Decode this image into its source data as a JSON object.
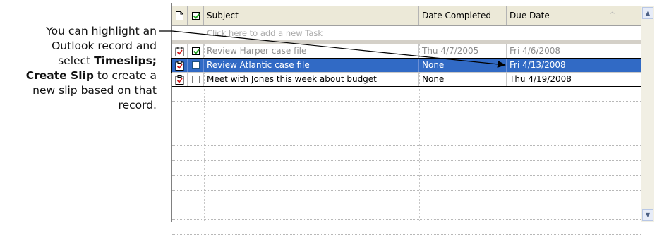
{
  "callout": {
    "line1": "You can highlight an",
    "line2": "Outlook record and",
    "line3_prefix": "select ",
    "line3_bold": "Timeslips;",
    "line4_bold": "Create Slip",
    "line4_suffix": " to create a",
    "line5": "new slip based on that",
    "line6": "record."
  },
  "columns": {
    "subject": "Subject",
    "date_completed": "Date Completed",
    "due_date": "Due Date",
    "sort_indicator": "^"
  },
  "add_row_placeholder": "Click here to add a new Task",
  "tasks": [
    {
      "subject": "Review Harper case file",
      "date_completed": "Thu 4/7/2005",
      "due_date": "Fri 4/6/2008",
      "checked": true,
      "state": "completed"
    },
    {
      "subject": "Review Atlantic case file",
      "date_completed": "None",
      "due_date": "Fri 4/13/2008",
      "checked": false,
      "state": "selected"
    },
    {
      "subject": "Meet with Jones this week about budget",
      "date_completed": "None",
      "due_date": "Thu 4/19/2008",
      "checked": false,
      "state": "normal"
    }
  ],
  "colors": {
    "selection": "#316ac5",
    "header_bg": "#ece9d8",
    "completed_text": "#8c8c8c",
    "annotation_line": "#000000"
  },
  "icons": {
    "header_type": "document-icon",
    "header_complete": "checkbox-icon",
    "task_row": "task-clipboard-icon",
    "scroll_up": "scroll-up-icon",
    "scroll_down": "scroll-down-icon"
  }
}
